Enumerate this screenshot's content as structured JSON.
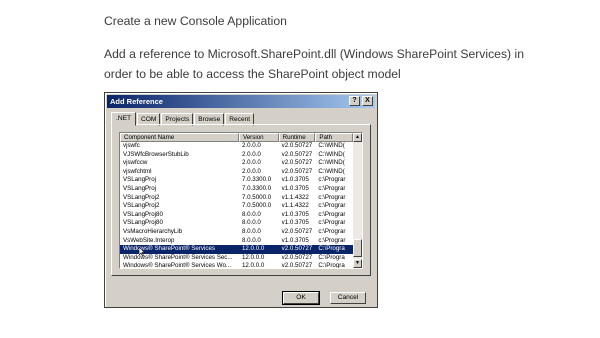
{
  "article": {
    "step1": "Create a new Console Application",
    "step2": "Add a reference to Microsoft.SharePoint.dll (Windows SharePoint Services) in order to be able to access the SharePoint object model"
  },
  "dialog": {
    "title": "Add Reference",
    "help_glyph": "?",
    "close_glyph": "X",
    "tabs": [
      ".NET",
      "COM",
      "Projects",
      "Browse",
      "Recent"
    ],
    "active_tab": ".NET",
    "columns": [
      "Component Name",
      "Version",
      "Runtime",
      "Path"
    ],
    "rows": [
      [
        "vjswfc",
        "2.0.0.0",
        "v2.0.50727",
        "C:\\WIND("
      ],
      [
        "VJSWfcBrowserStubLib",
        "2.0.0.0",
        "v2.0.50727",
        "C:\\WIND("
      ],
      [
        "vjswfccw",
        "2.0.0.0",
        "v2.0.50727",
        "C:\\WIND("
      ],
      [
        "vjswfchtml",
        "2.0.0.0",
        "v2.0.50727",
        "C:\\WIND("
      ],
      [
        "VSLangProj",
        "7.0.3300.0",
        "v1.0.3705",
        "c:\\Prograr"
      ],
      [
        "VSLangProj",
        "7.0.3300.0",
        "v1.0.3705",
        "c:\\Prograr"
      ],
      [
        "VSLangProj2",
        "7.0.5000.0",
        "v1.1.4322",
        "c:\\Prograr"
      ],
      [
        "VSLangProj2",
        "7.0.5000.0",
        "v1.1.4322",
        "c:\\Prograr"
      ],
      [
        "VSLangProj80",
        "8.0.0.0",
        "v1.0.3705",
        "c:\\Prograr"
      ],
      [
        "VSLangProj80",
        "8.0.0.0",
        "v1.0.3705",
        "c:\\Prograr"
      ],
      [
        "VsMacroHierarchyLib",
        "8.0.0.0",
        "v2.0.50727",
        "c:\\Prograr"
      ],
      [
        "VsWebSite.Interop",
        "8.0.0.0",
        "v1.0.3705",
        "c:\\Prograr"
      ],
      [
        "Windows® SharePoint® Services",
        "12.0.0.0",
        "v2.0.50727",
        "C:\\Progra"
      ],
      [
        "Windows® SharePoint® Services Sec...",
        "12.0.0.0",
        "v2.0.50727",
        "C:\\Progra"
      ],
      [
        "Windows® SharePoint® Services Wo...",
        "12.0.0.0",
        "v2.0.50727",
        "C:\\Progra"
      ]
    ],
    "selected_row": "Windows® SharePoint® Services",
    "ok_label": "OK",
    "cancel_label": "Cancel",
    "scroll_up_glyph": "▲",
    "scroll_down_glyph": "▼"
  }
}
